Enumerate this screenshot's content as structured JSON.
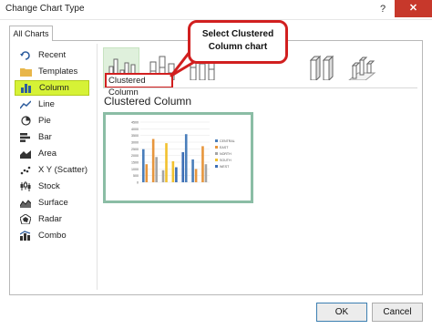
{
  "window": {
    "title": "Change Chart Type",
    "help_glyph": "?",
    "close_glyph": "✕"
  },
  "tabs": [
    {
      "label": "All Charts"
    }
  ],
  "sidebar": {
    "items": [
      {
        "label": "Recent",
        "icon": "recent-icon"
      },
      {
        "label": "Templates",
        "icon": "folder-icon"
      },
      {
        "label": "Column",
        "icon": "column-chart-icon",
        "selected": true
      },
      {
        "label": "Line",
        "icon": "line-chart-icon"
      },
      {
        "label": "Pie",
        "icon": "pie-chart-icon"
      },
      {
        "label": "Bar",
        "icon": "bar-chart-icon"
      },
      {
        "label": "Area",
        "icon": "area-chart-icon"
      },
      {
        "label": "X Y (Scatter)",
        "icon": "scatter-chart-icon"
      },
      {
        "label": "Stock",
        "icon": "stock-chart-icon"
      },
      {
        "label": "Surface",
        "icon": "surface-chart-icon"
      },
      {
        "label": "Radar",
        "icon": "radar-chart-icon"
      },
      {
        "label": "Combo",
        "icon": "combo-chart-icon"
      }
    ]
  },
  "subtypes": {
    "selected_label": "Clustered Column",
    "count": 7
  },
  "callout": {
    "text": "Select Clustered Column chart"
  },
  "main": {
    "chart_title": "Clustered Column"
  },
  "preview": {
    "y_ticks": [
      "4500",
      "4000",
      "3500",
      "3000",
      "2500",
      "2000",
      "1500",
      "1000",
      "500",
      "0"
    ],
    "legend": [
      {
        "name": "CENTRAL",
        "color": "#4a7ebb"
      },
      {
        "name": "EAST",
        "color": "#e7963c"
      },
      {
        "name": "NORTH",
        "color": "#a5a5a5"
      },
      {
        "name": "SOUTH",
        "color": "#f2c12e"
      },
      {
        "name": "WEST",
        "color": "#3d6fb6"
      }
    ]
  },
  "buttons": {
    "ok": "OK",
    "cancel": "Cancel"
  }
}
